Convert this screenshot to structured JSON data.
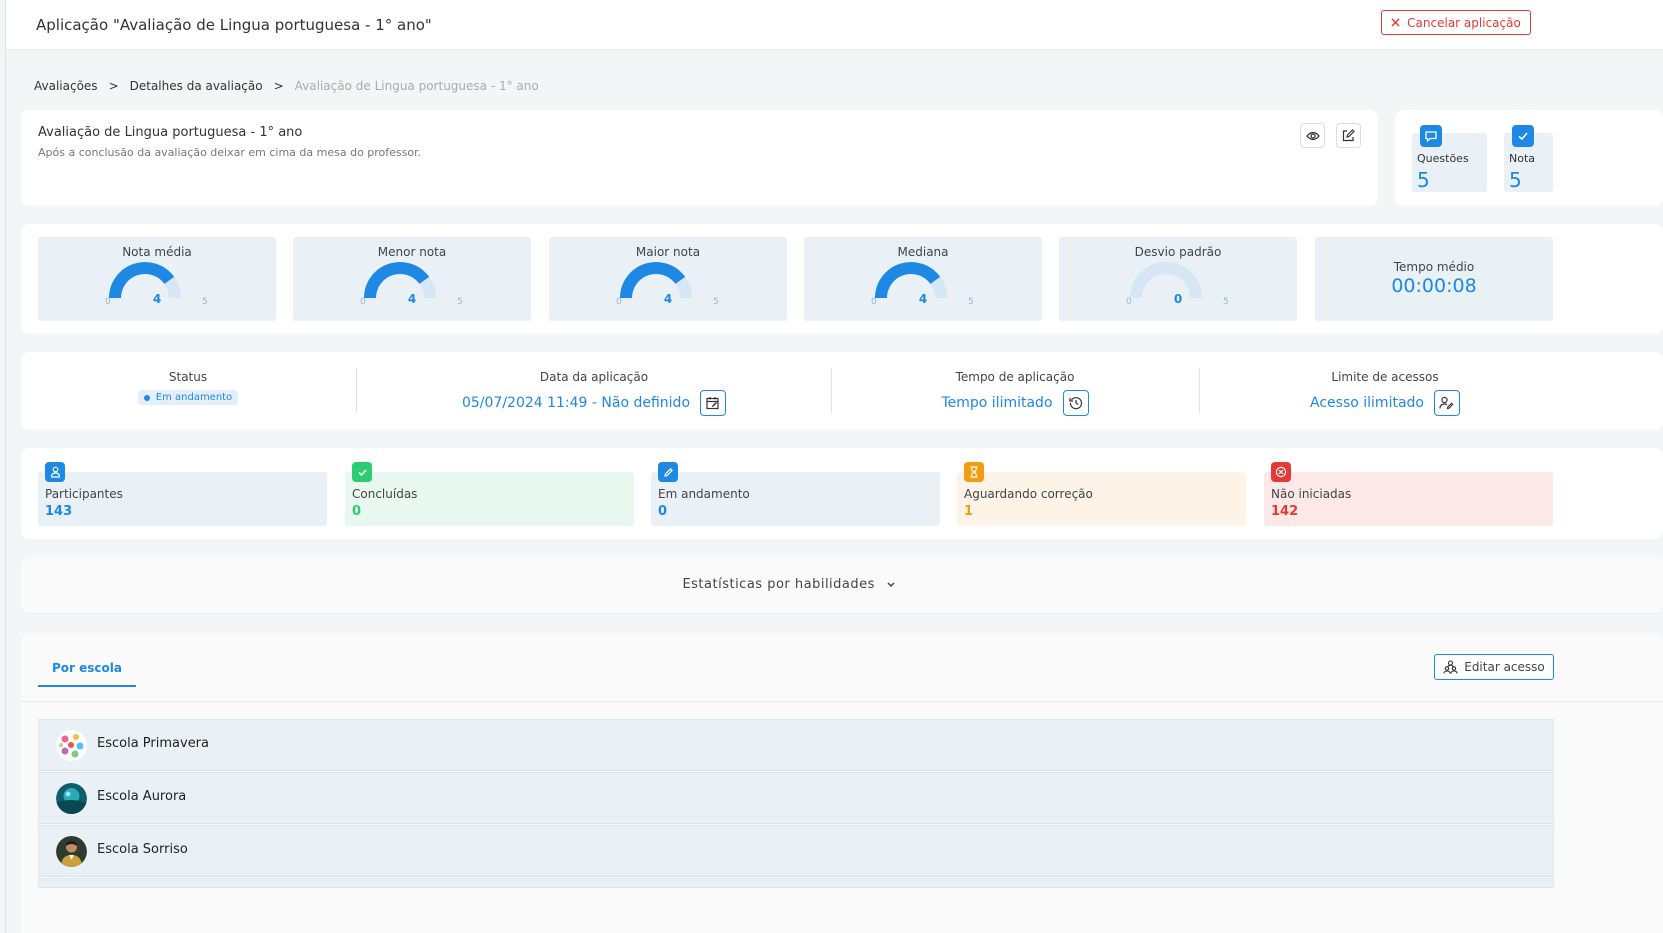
{
  "header": {
    "title": "Aplicação \"Avaliação de Lingua portuguesa - 1° ano\"",
    "cancel_label": "Cancelar aplicação"
  },
  "breadcrumb": [
    "Avaliações",
    "Detalhes da avaliação",
    "Avaliação de Lingua portuguesa - 1° ano"
  ],
  "assessment": {
    "title": "Avaliação de Lingua portuguesa - 1° ano",
    "description": "Após a conclusão da avaliação deixar em cima da mesa do professor.",
    "questions_label": "Questões",
    "questions_value": "5",
    "grade_label": "Nota",
    "grade_value": "5"
  },
  "stats": {
    "gauges": [
      {
        "label": "Nota média",
        "value": 4,
        "min": 0,
        "max": 5
      },
      {
        "label": "Menor nota",
        "value": 4,
        "min": 0,
        "max": 5
      },
      {
        "label": "Maior nota",
        "value": 4,
        "min": 0,
        "max": 5
      },
      {
        "label": "Mediana",
        "value": 4,
        "min": 0,
        "max": 5
      },
      {
        "label": "Desvio padrão",
        "value": 0,
        "min": 0,
        "max": 5
      }
    ],
    "avg_time_label": "Tempo médio",
    "avg_time_value": "00:00:08"
  },
  "info": {
    "status_label": "Status",
    "status_value": "Em andamento",
    "date_label": "Data da aplicação",
    "date_value": "05/07/2024 11:49 - Não definido",
    "time_label": "Tempo de aplicação",
    "time_value": "Tempo ilimitado",
    "access_label": "Limite de acessos",
    "access_value": "Acesso ilimitado"
  },
  "participants": [
    {
      "label": "Participantes",
      "value": "143",
      "color": "#1e88e5",
      "bg": "#e9f0f6"
    },
    {
      "label": "Concluídas",
      "value": "0",
      "color": "#2ecc71",
      "bg": "#e8f8ef"
    },
    {
      "label": "Em andamento",
      "value": "0",
      "color": "#1e88e5",
      "bg": "#e9f0f6"
    },
    {
      "label": "Aguardando correção",
      "value": "1",
      "color": "#f39c12",
      "bg": "#fdf3e7"
    },
    {
      "label": "Não iniciadas",
      "value": "142",
      "color": "#e53935",
      "bg": "#fde8e8"
    }
  ],
  "skills_label": "Estatísticas por habilidades",
  "tabs": {
    "by_school": "Por escola",
    "edit_access": "Editar acesso"
  },
  "schools": [
    "Escola Primavera",
    "Escola Aurora",
    "Escola Sorriso"
  ]
}
